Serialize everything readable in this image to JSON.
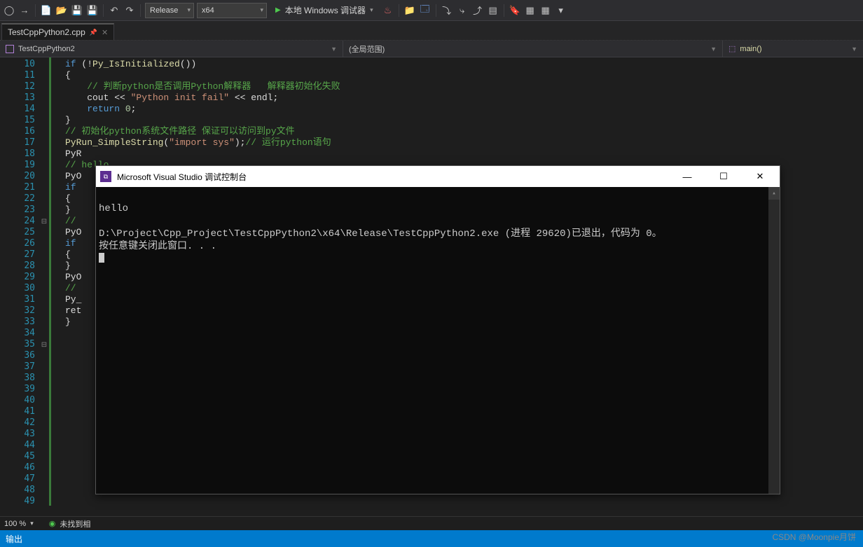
{
  "toolbar": {
    "config": "Release",
    "platform": "x64",
    "debug_label": "本地 Windows 调试器"
  },
  "tab": {
    "filename": "TestCppPython2.cpp"
  },
  "navbar": {
    "project": "TestCppPython2",
    "scope": "(全局范围)",
    "func": "main()"
  },
  "line_start": 10,
  "line_end": 49,
  "code_lines": [
    {
      "n": 10,
      "fold": "",
      "html": "<span class='kw'>if</span> (!<span class='func'>Py_IsInitialized</span>())"
    },
    {
      "n": 11,
      "fold": "",
      "html": "{"
    },
    {
      "n": 12,
      "fold": "",
      "html": "    <span class='cmt'>// 判断python是否调用Python解释器   解释器初始化失败</span>"
    },
    {
      "n": 13,
      "fold": "",
      "html": "    cout << <span class='str'>\"Python init fail\"</span> << endl;"
    },
    {
      "n": 14,
      "fold": "",
      "html": "    <span class='kw'>return</span> <span class='num'>0</span>;"
    },
    {
      "n": 15,
      "fold": "",
      "html": "}"
    },
    {
      "n": 16,
      "fold": "",
      "html": ""
    },
    {
      "n": 17,
      "fold": "",
      "html": "<span class='cmt'>// 初始化python系统文件路径 保证可以访问到py文件</span>"
    },
    {
      "n": 18,
      "fold": "",
      "html": "<span class='func'>PyRun_SimpleString</span>(<span class='str'>\"import sys\"</span>);<span class='cmt'>// 运行python语句</span>"
    },
    {
      "n": 19,
      "fold": "",
      "html": "PyR"
    },
    {
      "n": 20,
      "fold": "",
      "html": ""
    },
    {
      "n": 21,
      "fold": "",
      "html": "<span class='cmt'>// hello</span>"
    },
    {
      "n": 22,
      "fold": "",
      "html": "PyO"
    },
    {
      "n": 23,
      "fold": "",
      "html": "",
      "hl": true
    },
    {
      "n": 24,
      "fold": "⊟",
      "html": "<span class='kw'>if</span>"
    },
    {
      "n": 25,
      "fold": "",
      "html": "{"
    },
    {
      "n": 26,
      "fold": "",
      "html": ""
    },
    {
      "n": 27,
      "fold": "",
      "html": ""
    },
    {
      "n": 28,
      "fold": "",
      "html": ""
    },
    {
      "n": 29,
      "fold": "",
      "html": "}"
    },
    {
      "n": 30,
      "fold": "",
      "html": ""
    },
    {
      "n": 31,
      "fold": "",
      "html": "<span class='cmt'>//</span>"
    },
    {
      "n": 32,
      "fold": "",
      "html": "PyO"
    },
    {
      "n": 33,
      "fold": "",
      "html": ""
    },
    {
      "n": 34,
      "fold": "",
      "html": ""
    },
    {
      "n": 35,
      "fold": "⊟",
      "html": "<span class='kw'>if</span>"
    },
    {
      "n": 36,
      "fold": "",
      "html": "{"
    },
    {
      "n": 37,
      "fold": "",
      "html": ""
    },
    {
      "n": 38,
      "fold": "",
      "html": ""
    },
    {
      "n": 39,
      "fold": "",
      "html": ""
    },
    {
      "n": 40,
      "fold": "",
      "html": "}"
    },
    {
      "n": 41,
      "fold": "",
      "html": ""
    },
    {
      "n": 42,
      "fold": "",
      "html": "PyO"
    },
    {
      "n": 43,
      "fold": "",
      "html": ""
    },
    {
      "n": 44,
      "fold": "",
      "html": "<span class='cmt'>//</span>"
    },
    {
      "n": 45,
      "fold": "",
      "html": "Py_"
    },
    {
      "n": 46,
      "fold": "",
      "html": "ret"
    },
    {
      "n": 47,
      "fold": "",
      "html": ""
    },
    {
      "n": 48,
      "fold": "",
      "html": "}"
    },
    {
      "n": 49,
      "fold": "",
      "html": ""
    }
  ],
  "status": {
    "zoom": "100 %",
    "issues": "未找到相"
  },
  "output_label": "输出",
  "console": {
    "title": "Microsoft Visual Studio 调试控制台",
    "line1": "hello",
    "line2_pre": "D:\\Project\\Cpp_Project\\TestCppPython2\\x64\\Release\\TestCppPython2.exe (进程 29620)已退出，代码为 0。",
    "line3": "按任意键关闭此窗口. . ."
  },
  "watermark": "CSDN @Moonpie月饼"
}
